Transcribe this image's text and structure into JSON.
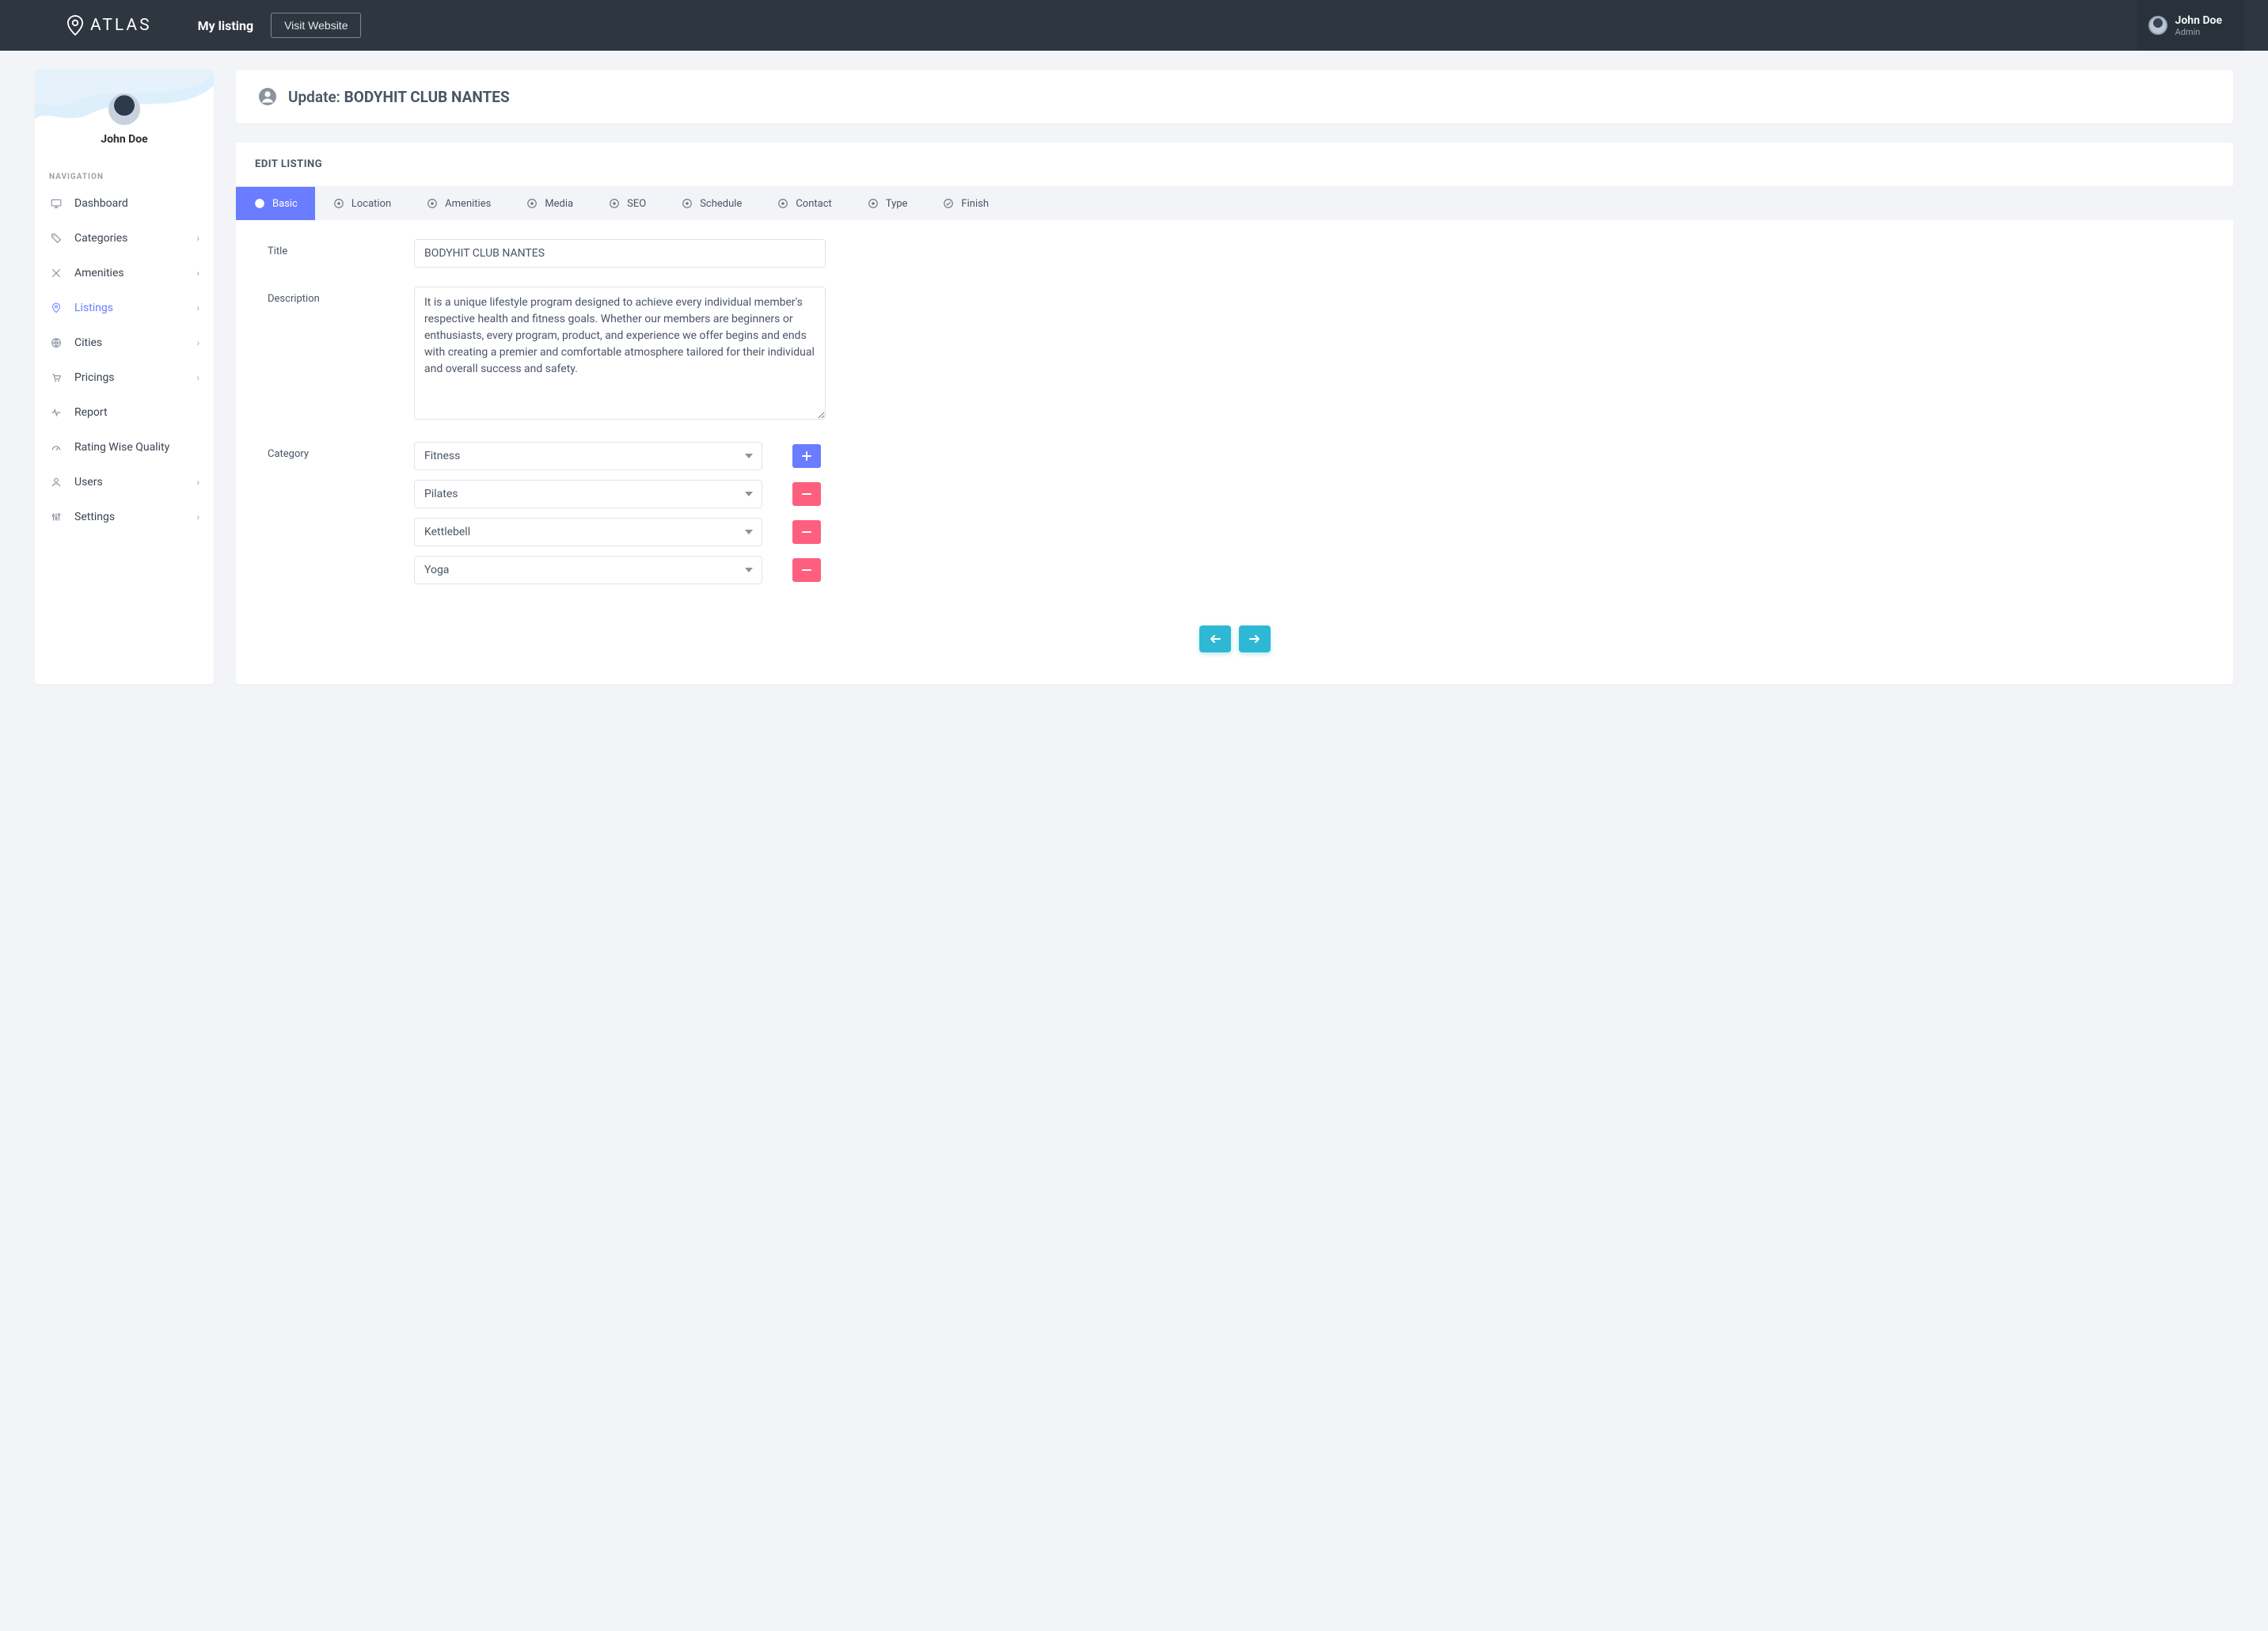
{
  "brand": {
    "name": "ATLAS"
  },
  "topbar": {
    "my_listing": "My listing",
    "visit_website": "Visit Website"
  },
  "user": {
    "name": "John Doe",
    "role": "Admin"
  },
  "sidebar": {
    "profile_name": "John Doe",
    "section_label": "NAVIGATION",
    "items": [
      {
        "label": "Dashboard",
        "icon": "monitor-icon",
        "expandable": false,
        "active": false
      },
      {
        "label": "Categories",
        "icon": "tag-icon",
        "expandable": true,
        "active": false
      },
      {
        "label": "Amenities",
        "icon": "crossed-icon",
        "expandable": true,
        "active": false
      },
      {
        "label": "Listings",
        "icon": "pin-icon",
        "expandable": true,
        "active": true
      },
      {
        "label": "Cities",
        "icon": "globe-icon",
        "expandable": true,
        "active": false
      },
      {
        "label": "Pricings",
        "icon": "cart-icon",
        "expandable": true,
        "active": false
      },
      {
        "label": "Report",
        "icon": "pulse-icon",
        "expandable": false,
        "active": false
      },
      {
        "label": "Rating Wise Quality",
        "icon": "gauge-icon",
        "expandable": false,
        "active": false
      },
      {
        "label": "Users",
        "icon": "user-icon",
        "expandable": true,
        "active": false
      },
      {
        "label": "Settings",
        "icon": "sliders-icon",
        "expandable": true,
        "active": false
      }
    ]
  },
  "page_header": {
    "prefix": "Update:",
    "title": "BODYHIT CLUB NANTES"
  },
  "form": {
    "heading": "EDIT LISTING",
    "tabs": [
      {
        "label": "Basic",
        "icon": "user-circle-icon",
        "state": "active"
      },
      {
        "label": "Location",
        "icon": "circle-dot-icon",
        "state": "idle"
      },
      {
        "label": "Amenities",
        "icon": "circle-dot-icon",
        "state": "idle"
      },
      {
        "label": "Media",
        "icon": "circle-dot-icon",
        "state": "idle"
      },
      {
        "label": "SEO",
        "icon": "circle-dot-icon",
        "state": "idle"
      },
      {
        "label": "Schedule",
        "icon": "circle-dot-icon",
        "state": "idle"
      },
      {
        "label": "Contact",
        "icon": "circle-dot-icon",
        "state": "idle"
      },
      {
        "label": "Type",
        "icon": "circle-dot-icon",
        "state": "idle"
      },
      {
        "label": "Finish",
        "icon": "check-circle-icon",
        "state": "idle"
      }
    ],
    "fields": {
      "title_label": "Title",
      "title_value": "BODYHIT CLUB NANTES",
      "description_label": "Description",
      "description_value": "It is a unique lifestyle program designed to achieve every individual member's respective health and fitness goals. Whether our members are beginners or enthusiasts, every program, product, and experience we offer begins and ends with creating a premier and comfortable atmosphere tailored for their individual and overall success and safety.",
      "category_label": "Category",
      "categories": [
        {
          "value": "Fitness",
          "action": "add"
        },
        {
          "value": "Pilates",
          "action": "remove"
        },
        {
          "value": "Kettlebell",
          "action": "remove"
        },
        {
          "value": "Yoga",
          "action": "remove"
        }
      ]
    },
    "nav": {
      "prev": "previous",
      "next": "next"
    }
  }
}
